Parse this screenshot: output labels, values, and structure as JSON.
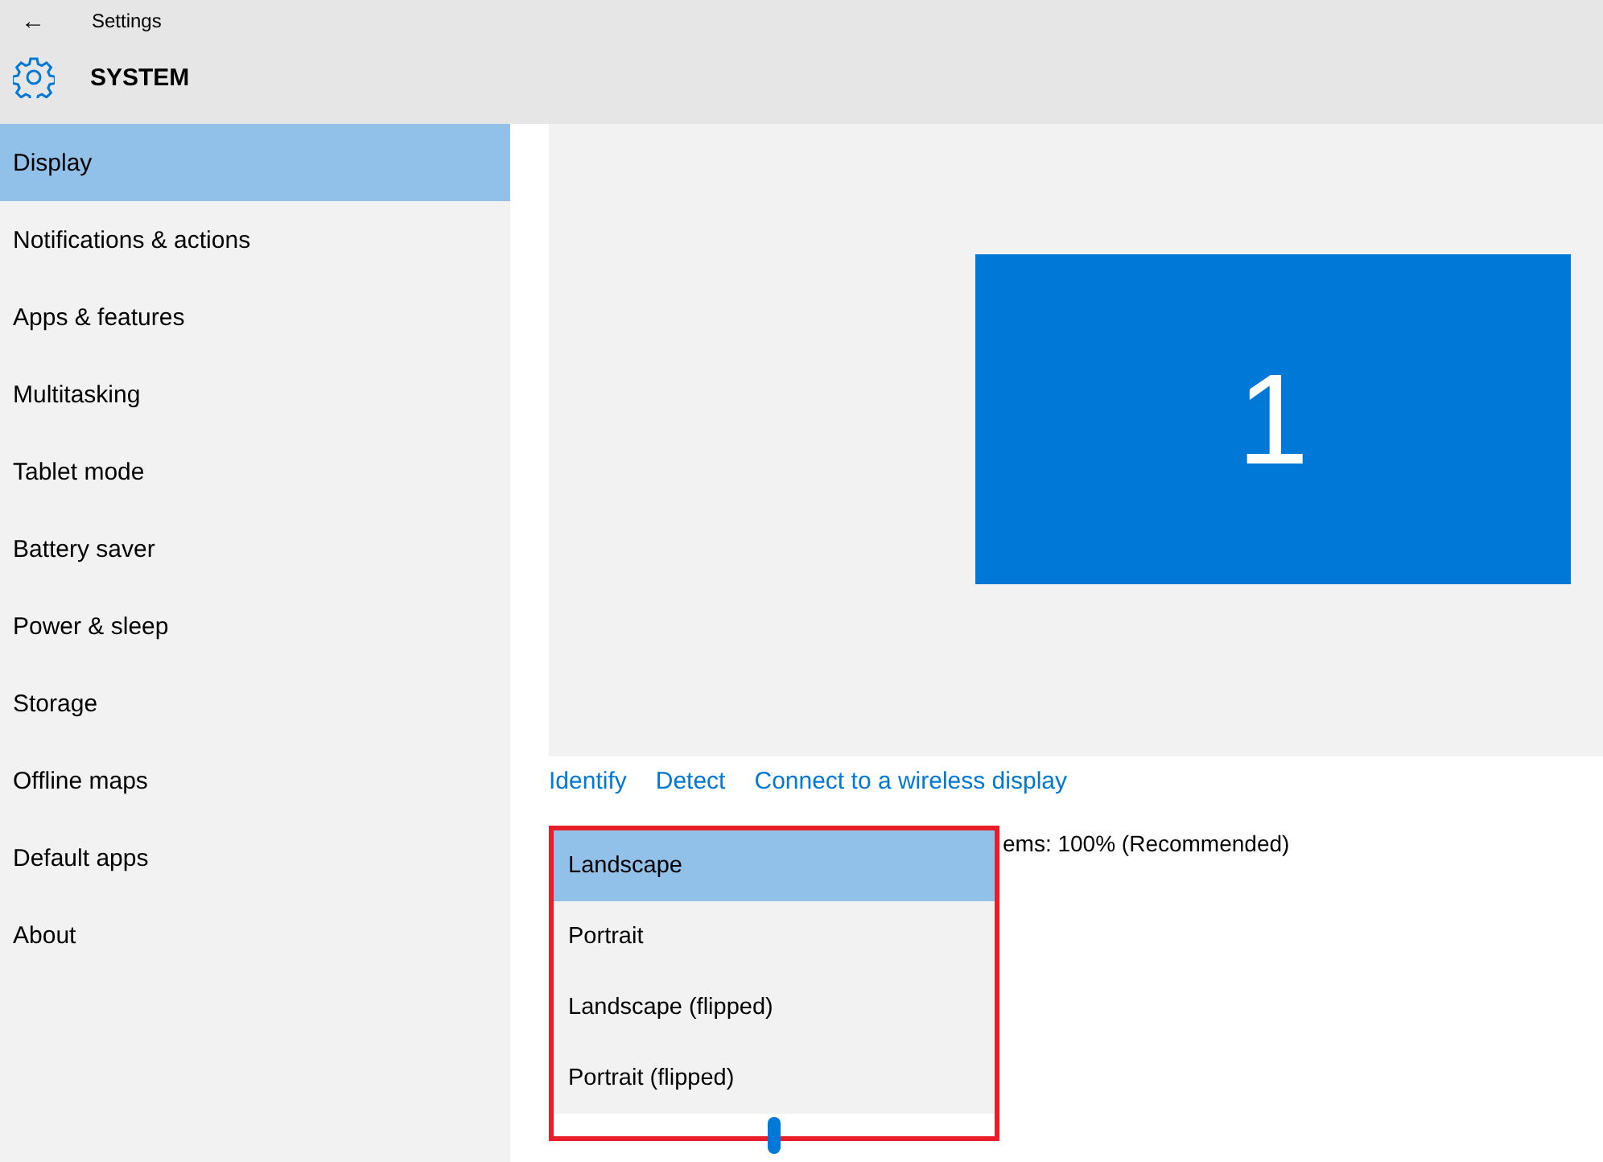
{
  "window": {
    "title": "Settings",
    "back": "←"
  },
  "header": {
    "title": "SYSTEM"
  },
  "sidebar": {
    "items": [
      {
        "label": "Display",
        "selected": true
      },
      {
        "label": "Notifications & actions",
        "selected": false
      },
      {
        "label": "Apps & features",
        "selected": false
      },
      {
        "label": "Multitasking",
        "selected": false
      },
      {
        "label": "Tablet mode",
        "selected": false
      },
      {
        "label": "Battery saver",
        "selected": false
      },
      {
        "label": "Power & sleep",
        "selected": false
      },
      {
        "label": "Storage",
        "selected": false
      },
      {
        "label": "Offline maps",
        "selected": false
      },
      {
        "label": "Default apps",
        "selected": false
      },
      {
        "label": "About",
        "selected": false
      }
    ]
  },
  "preview": {
    "monitor": "1"
  },
  "links": [
    "Identify",
    "Detect",
    "Connect to a wireless display"
  ],
  "scale_text": "ems: 100% (Recommended)",
  "orientation_menu": {
    "options": [
      {
        "label": "Landscape",
        "selected": true
      },
      {
        "label": "Portrait",
        "selected": false
      },
      {
        "label": "Landscape (flipped)",
        "selected": false
      },
      {
        "label": "Portrait (flipped)",
        "selected": false
      }
    ]
  }
}
